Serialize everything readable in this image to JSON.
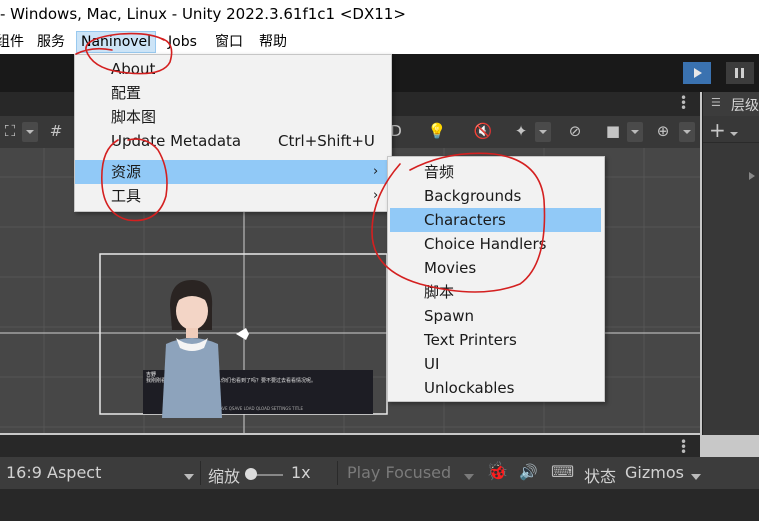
{
  "window": {
    "title": "- Windows, Mac, Linux - Unity 2022.3.61f1c1 <DX11>"
  },
  "menubar": [
    "组件",
    "服务",
    "Naninovel",
    "Jobs",
    "窗口",
    "帮助"
  ],
  "naninovel_menu": {
    "items": [
      {
        "label": "About"
      },
      {
        "label": "配置"
      },
      {
        "label": "脚本图"
      },
      {
        "label": "Update Metadata",
        "shortcut": "Ctrl+Shift+U"
      },
      {
        "label": "资源",
        "submenu": true,
        "highlighted": true
      },
      {
        "label": "工具",
        "submenu": true
      }
    ]
  },
  "resources_submenu": {
    "items": [
      "音频",
      "Backgrounds",
      "Characters",
      "Choice Handlers",
      "Movies",
      "脚本",
      "Spawn",
      "Text Printers",
      "UI",
      "Unlockables"
    ],
    "highlighted": "Characters"
  },
  "hierarchy": {
    "title": "层级"
  },
  "game_view": {
    "aspect": "16:9 Aspect",
    "scale_label": "缩放",
    "scale_value": "1x",
    "play_mode": "Play Focused",
    "stats": "状态",
    "gizmos": "Gizmos"
  },
  "scene_preview": {
    "name_tag": "吉野",
    "dialogue": "我刚刚看到了什么东西在那边……你们也看到了吗？要不要过去看看情况呢。",
    "footer": "LOG AUTO SKIP SAVE QSAVE LOAD QLOAD SETTINGS TITLE"
  },
  "colors": {
    "accent": "#3a72b0",
    "selection": "#91c9f7",
    "annotation": "#d42020"
  }
}
